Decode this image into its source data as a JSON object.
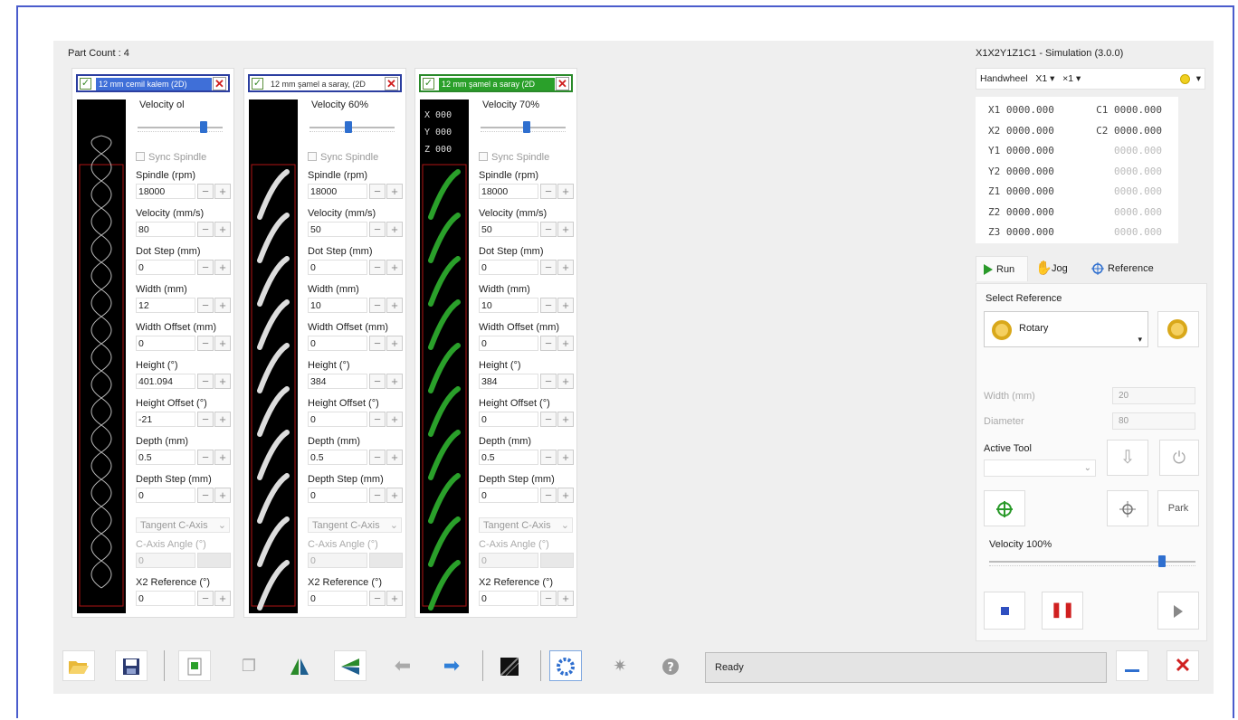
{
  "part_count": "Part Count : 4",
  "parts": [
    {
      "name": "12 mm cemil kalem (2D)",
      "velocity_label": "Velocity",
      "velocity_value": "ol",
      "velocity_percent": 0.8,
      "sync_label": "Sync Spindle",
      "fields": [
        {
          "label": "Spindle (rpm)",
          "value": "18000"
        },
        {
          "label": "Velocity (mm/s)",
          "value": "80"
        },
        {
          "label": "Dot Step (mm)",
          "value": "0"
        },
        {
          "label": "Width (mm)",
          "value": "12"
        },
        {
          "label": "Width Offset (mm)",
          "value": "0"
        },
        {
          "label": "Height (°)",
          "value": "401.094"
        },
        {
          "label": "Height Offset (°)",
          "value": "-21"
        },
        {
          "label": "Depth (mm)",
          "value": "0.5"
        },
        {
          "label": "Depth Step (mm)",
          "value": "0"
        }
      ],
      "tangent": "Tangent C-Axis",
      "caxis_label": "C-Axis Angle (°)",
      "caxis_value": "0",
      "x2_label": "X2 Reference (°)",
      "x2_value": "0"
    },
    {
      "name": "12 mm şamel a saray, (2D",
      "velocity_label": "Velocity",
      "velocity_value": "60%",
      "velocity_percent": 0.45,
      "sync_label": "Sync Spindle",
      "fields": [
        {
          "label": "Spindle (rpm)",
          "value": "18000"
        },
        {
          "label": "Velocity (mm/s)",
          "value": "50"
        },
        {
          "label": "Dot Step (mm)",
          "value": "0"
        },
        {
          "label": "Width (mm)",
          "value": "10"
        },
        {
          "label": "Width Offset (mm)",
          "value": "0"
        },
        {
          "label": "Height (°)",
          "value": "384"
        },
        {
          "label": "Height Offset (°)",
          "value": "0"
        },
        {
          "label": "Depth (mm)",
          "value": "0.5"
        },
        {
          "label": "Depth Step (mm)",
          "value": "0"
        }
      ],
      "tangent": "Tangent C-Axis",
      "caxis_label": "C-Axis Angle (°)",
      "caxis_value": "0",
      "x2_label": "X2 Reference (°)",
      "x2_value": "0"
    },
    {
      "name": "12 mm şamel a saray (2D",
      "velocity_label": "Velocity",
      "velocity_value": "70%",
      "velocity_percent": 0.55,
      "sync_label": "Sync Spindle",
      "coords": [
        "X 000",
        "Y 000",
        "Z 000"
      ],
      "fields": [
        {
          "label": "Spindle (rpm)",
          "value": "18000"
        },
        {
          "label": "Velocity (mm/s)",
          "value": "50"
        },
        {
          "label": "Dot Step (mm)",
          "value": "0"
        },
        {
          "label": "Width (mm)",
          "value": "10"
        },
        {
          "label": "Width Offset (mm)",
          "value": "0"
        },
        {
          "label": "Height (°)",
          "value": "384"
        },
        {
          "label": "Height Offset (°)",
          "value": "0"
        },
        {
          "label": "Depth (mm)",
          "value": "0.5"
        },
        {
          "label": "Depth Step (mm)",
          "value": "0"
        }
      ],
      "tangent": "Tangent C-Axis",
      "caxis_label": "C-Axis Angle (°)",
      "caxis_value": "0",
      "x2_label": "X2 Reference (°)",
      "x2_value": "0"
    }
  ],
  "right": {
    "title": "X1X2Y1Z1C1 - Simulation (3.0.0)",
    "handwheel": {
      "label": "Handwheel",
      "axis": "X1",
      "mult": "×1",
      "dd": "▾"
    },
    "axes": [
      {
        "l": "X1 0000.000",
        "r": "C1 0000.000"
      },
      {
        "l": "X2 0000.000",
        "r": "C2 0000.000"
      },
      {
        "l": "Y1 0000.000",
        "r": "0000.000"
      },
      {
        "l": "Y2 0000.000",
        "r": "0000.000"
      },
      {
        "l": "Z1 0000.000",
        "r": "0000.000"
      },
      {
        "l": "Z2 0000.000",
        "r": "0000.000"
      },
      {
        "l": "Z3 0000.000",
        "r": "0000.000"
      }
    ],
    "tabs": {
      "run": "Run",
      "jog": "Jog",
      "reference": "Reference"
    },
    "select_reference": "Select Reference",
    "rotary": "Rotary",
    "width_label": "Width (mm)",
    "width_value": "20",
    "diameter_label": "Diameter",
    "diameter_value": "80",
    "active_tool": "Active Tool",
    "park": "Park",
    "velocity_label": "Velocity 100%",
    "velocity_percent": 0.85
  },
  "status": "Ready",
  "colors": {
    "accent": "#2f6fcf",
    "close": "#d02020",
    "green": "#2aa02a"
  }
}
